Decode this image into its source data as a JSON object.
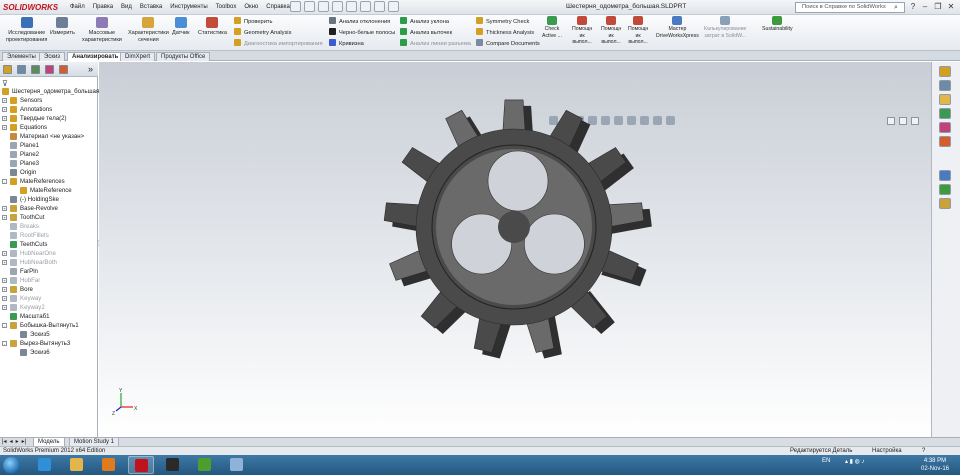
{
  "app": {
    "logo_text": "SOLIDWORKS",
    "document_title": "Шестерня_одометра_большая.SLDPRT",
    "search_placeholder": "Поиск в Справке по SolidWorks",
    "minimize_symbol": "–",
    "restore_symbol": "❐",
    "close_symbol": "✕",
    "search_icon": "search-icon",
    "help_icon": "help-icon"
  },
  "menus": [
    "Файл",
    "Правка",
    "Вид",
    "Вставка",
    "Инструменты",
    "Toolbox",
    "Окно",
    "Справка"
  ],
  "ribbon": {
    "big_buttons": [
      {
        "label": "Исследование\nпроектирования",
        "icon": "design-study-icon",
        "color": "#3d6fb4"
      },
      {
        "label": "Измерить",
        "icon": "measure-icon",
        "color": "#6b7f96"
      },
      {
        "label": "Массовые\nхарактеристики",
        "icon": "mass-properties-icon",
        "color": "#8f7ab8"
      },
      {
        "label": "Характеристики\nсечения",
        "icon": "section-properties-icon",
        "color": "#d7a33b"
      },
      {
        "label": "Датчик",
        "icon": "sensor-icon",
        "color": "#4a8fd6"
      },
      {
        "label": "Статистика",
        "icon": "statistics-icon",
        "color": "#c44b3a"
      }
    ],
    "col1": [
      {
        "label": "Проверить",
        "icon": "check-icon",
        "color": "#d4a023",
        "disabled": false
      },
      {
        "label": "Geometry Analysis",
        "icon": "geometry-analysis-icon",
        "color": "#d4a023",
        "disabled": false
      },
      {
        "label": "Диагностика импортирования",
        "icon": "import-diagnostics-icon",
        "color": "#d4a023",
        "disabled": true
      }
    ],
    "col2": [
      {
        "label": "Анализ отклонения",
        "icon": "deviation-analysis-icon",
        "color": "#6a7480",
        "disabled": false
      },
      {
        "label": "Черно-белые полосы",
        "icon": "zebra-stripes-icon",
        "color": "#1f1f1f",
        "disabled": false
      },
      {
        "label": "Кривизна",
        "icon": "curvature-icon",
        "color": "#3a5bd1",
        "disabled": false
      }
    ],
    "col3": [
      {
        "label": "Анализ уклона",
        "icon": "draft-analysis-icon",
        "color": "#2b9c4a",
        "disabled": false
      },
      {
        "label": "Анализ выточек",
        "icon": "undercut-analysis-icon",
        "color": "#2b9c4a",
        "disabled": false
      },
      {
        "label": "Анализ линии разъема",
        "icon": "parting-line-icon",
        "color": "#2b9c4a",
        "disabled": true
      }
    ],
    "col4": [
      {
        "label": "Symmetry Check",
        "icon": "symmetry-check-icon",
        "color": "#d4a023",
        "disabled": false
      },
      {
        "label": "Thickness Analysis",
        "icon": "thickness-analysis-icon",
        "color": "#d4a023",
        "disabled": false
      },
      {
        "label": "Compare Documents",
        "icon": "compare-documents-icon",
        "color": "#7a8aa0",
        "disabled": false
      }
    ],
    "right_buttons": [
      {
        "label": "Check\nActive ...",
        "icon": "check-active-icon",
        "color": "#3b9a52",
        "disabled": false
      },
      {
        "label": "Помощн\nик\nвыпол...",
        "icon": "molding-assistant-icon",
        "color": "#c24a3b",
        "disabled": false
      },
      {
        "label": "Помощн\nик\nвыпол...",
        "icon": "wizard-icon",
        "color": "#c24a3b",
        "disabled": false
      },
      {
        "label": "Помощн\nик\nвыпол...",
        "icon": "wizard-icon",
        "color": "#c24a3b",
        "disabled": false
      },
      {
        "label": "Мастер\nDriveWorksXpress",
        "icon": "driveworks-icon",
        "color": "#4a7bc0",
        "disabled": false
      },
      {
        "label": "Калькулирование\nзатрат в SolidW...",
        "icon": "costing-icon",
        "color": "#8aa0b8",
        "disabled": true
      },
      {
        "label": "Sustainability",
        "icon": "sustainability-icon",
        "color": "#3c9b3c",
        "disabled": false
      }
    ]
  },
  "tabs": [
    {
      "label": "Элементы",
      "active": false
    },
    {
      "label": "Эскиз",
      "active": false
    },
    {
      "label": "Анализировать",
      "active": true
    },
    {
      "label": "DimXpert",
      "active": false
    },
    {
      "label": "Продукты Office",
      "active": false
    }
  ],
  "panel": {
    "filter_icon": "filter-icon",
    "expand_symbol": "»",
    "sash_symbol": "⁞",
    "tool_icons": [
      {
        "name": "feature-manager-icon",
        "color": "#d4a023"
      },
      {
        "name": "property-manager-icon",
        "color": "#6d8aa6"
      },
      {
        "name": "configuration-manager-icon",
        "color": "#5c8c5c"
      },
      {
        "name": "dimxpert-manager-icon",
        "color": "#c2417a"
      },
      {
        "name": "display-manager-icon",
        "color": "#d65c2b"
      }
    ]
  },
  "tree": [
    {
      "label": "Шестерня_одометра_большая",
      "level": 0,
      "expander": "",
      "icon": "part-icon",
      "color": "#d4a023",
      "dim": false
    },
    {
      "label": "Sensors",
      "level": 1,
      "expander": "+",
      "icon": "sensors-folder-icon",
      "color": "#d4a023",
      "dim": false
    },
    {
      "label": "Annotations",
      "level": 1,
      "expander": "+",
      "icon": "annotations-icon",
      "color": "#d4a023",
      "dim": false
    },
    {
      "label": "Твердые тела(2)",
      "level": 1,
      "expander": "+",
      "icon": "solid-bodies-folder-icon",
      "color": "#d4a023",
      "dim": false
    },
    {
      "label": "Equations",
      "level": 1,
      "expander": "+",
      "icon": "equations-icon",
      "color": "#d4a023",
      "dim": false
    },
    {
      "label": "Материал <не указан>",
      "level": 1,
      "expander": "",
      "icon": "material-icon",
      "color": "#c4893a",
      "dim": false
    },
    {
      "label": "Plane1",
      "level": 1,
      "expander": "",
      "icon": "plane-icon",
      "color": "#9aa6b2",
      "dim": false
    },
    {
      "label": "Plane2",
      "level": 1,
      "expander": "",
      "icon": "plane-icon",
      "color": "#9aa6b2",
      "dim": false
    },
    {
      "label": "Plane3",
      "level": 1,
      "expander": "",
      "icon": "plane-icon",
      "color": "#9aa6b2",
      "dim": false
    },
    {
      "label": "Origin",
      "level": 1,
      "expander": "",
      "icon": "origin-icon",
      "color": "#7a8896",
      "dim": false
    },
    {
      "label": "MateReferences",
      "level": 1,
      "expander": "-",
      "icon": "mate-references-folder-icon",
      "color": "#d4a023",
      "dim": false
    },
    {
      "label": "MateReference",
      "level": 2,
      "expander": "",
      "icon": "mate-reference-icon",
      "color": "#d4a023",
      "dim": false
    },
    {
      "label": "(-) HoldingSke",
      "level": 1,
      "expander": "",
      "icon": "sketch-icon",
      "color": "#7a8896",
      "dim": false
    },
    {
      "label": "Base-Revolve",
      "level": 1,
      "expander": "+",
      "icon": "revolve-icon",
      "color": "#c9a23a",
      "dim": false
    },
    {
      "label": "ToothCut",
      "level": 1,
      "expander": "+",
      "icon": "cut-extrude-icon",
      "color": "#c9a23a",
      "dim": false
    },
    {
      "label": "Breaks",
      "level": 1,
      "expander": "",
      "icon": "feature-icon",
      "color": "#b0b8c2",
      "dim": true
    },
    {
      "label": "RootFillets",
      "level": 1,
      "expander": "",
      "icon": "fillet-icon",
      "color": "#b0b8c2",
      "dim": true
    },
    {
      "label": "TeethCuts",
      "level": 1,
      "expander": "",
      "icon": "circular-pattern-icon",
      "color": "#3b9a52",
      "dim": false
    },
    {
      "label": "HubNearOne",
      "level": 1,
      "expander": "+",
      "icon": "extrude-icon",
      "color": "#b0b8c2",
      "dim": true
    },
    {
      "label": "HubNearBoth",
      "level": 1,
      "expander": "+",
      "icon": "extrude-icon",
      "color": "#b0b8c2",
      "dim": true
    },
    {
      "label": "FarPln",
      "level": 1,
      "expander": "",
      "icon": "plane-icon",
      "color": "#9aa6b2",
      "dim": false
    },
    {
      "label": "HubFar",
      "level": 1,
      "expander": "+",
      "icon": "extrude-icon",
      "color": "#b0b8c2",
      "dim": true
    },
    {
      "label": "Bore",
      "level": 1,
      "expander": "+",
      "icon": "cut-extrude-icon",
      "color": "#c9a23a",
      "dim": false
    },
    {
      "label": "Keyway",
      "level": 1,
      "expander": "+",
      "icon": "cut-extrude-icon",
      "color": "#b0b8c2",
      "dim": true
    },
    {
      "label": "Keyway2",
      "level": 1,
      "expander": "+",
      "icon": "cut-extrude-icon",
      "color": "#b0b8c2",
      "dim": true
    },
    {
      "label": "Масштаб1",
      "level": 1,
      "expander": "",
      "icon": "scale-icon",
      "color": "#3b9a52",
      "dim": false
    },
    {
      "label": "Бобышка-Вытянуть1",
      "level": 1,
      "expander": "-",
      "icon": "boss-extrude-icon",
      "color": "#c9a23a",
      "dim": false
    },
    {
      "label": "Эскиз5",
      "level": 2,
      "expander": "",
      "icon": "sketch-icon",
      "color": "#7a8896",
      "dim": false
    },
    {
      "label": "Вырез-Вытянуть3",
      "level": 1,
      "expander": "-",
      "icon": "cut-extrude-icon",
      "color": "#c9a23a",
      "dim": false
    },
    {
      "label": "Эскиз6",
      "level": 2,
      "expander": "",
      "icon": "sketch-icon",
      "color": "#7a8896",
      "dim": false
    }
  ],
  "viewport": {
    "gear_color": "#4a4a4a",
    "gear_highlight": "#6a6a6a",
    "gear_shadow": "#2f2f2f",
    "triad_labels": {
      "x": "X",
      "y": "Y",
      "z": "Z"
    },
    "view_tool_icons": [
      "zoom-to-fit-icon",
      "zoom-area-icon",
      "previous-view-icon",
      "section-view-icon",
      "view-orientation-icon",
      "display-style-icon",
      "hide-show-icon",
      "edit-appearance-icon",
      "scene-icon",
      "view-settings-icon"
    ],
    "window_controls": {
      "restore": "restore-view-icon",
      "maximize": "maximize-view-icon",
      "close": "close-view-icon"
    }
  },
  "task_pane_icons": [
    "resources-icon",
    "design-library-icon",
    "file-explorer-icon",
    "search-icon",
    "view-palette-icon",
    "appearances-icon",
    "custom-properties-icon",
    "solidworks-forum-icon",
    "task-icon"
  ],
  "bottom_tabs": [
    {
      "label": "Модель",
      "active": true
    },
    {
      "label": "Motion Study 1",
      "active": false
    }
  ],
  "nav_arrows": [
    "|◂",
    "◂",
    "▸",
    "▸|"
  ],
  "status": {
    "left": "SolidWorks Premium 2012 x64 Edition",
    "editing": "Редактируется Деталь",
    "settings": "Настройка",
    "help_symbol": "?"
  },
  "taskbar": {
    "apps": [
      {
        "name": "internet-explorer-icon",
        "color": "#2f8fd8",
        "active": false
      },
      {
        "name": "file-explorer-icon",
        "color": "#e3b54a",
        "active": false
      },
      {
        "name": "media-player-icon",
        "color": "#e07a1c",
        "active": false
      },
      {
        "name": "solidworks-icon",
        "color": "#c0141c",
        "active": true
      },
      {
        "name": "autocad-icon",
        "color": "#2a2a2a",
        "active": false
      },
      {
        "name": "minecraft-icon",
        "color": "#4f9d2f",
        "active": false
      },
      {
        "name": "drawing-tool-icon",
        "color": "#8fb2d8",
        "active": false
      }
    ],
    "lang": "EN",
    "time": "4:38 PM",
    "date": "02-Nov-16"
  }
}
